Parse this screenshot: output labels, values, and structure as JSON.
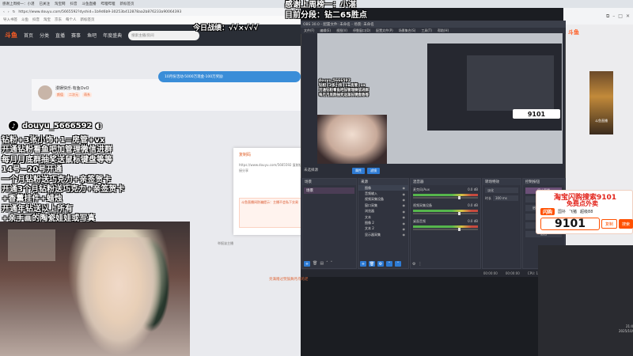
{
  "browser": {
    "tabs": [
      "感谢上周榜一：小湛",
      "已关注",
      "淘宝网",
      "抖音",
      "斗鱼直播",
      "哔哩哔哩",
      "新标签页"
    ],
    "url": "https://www.douyu.com/5665592?dyshid=1b9d6b9-30253b412878aa2b876233a90064393",
    "bookmarks": [
      "导入书签",
      "斗鱼",
      "抖音",
      "淘宝",
      "京东",
      "每个人",
      "新标签页"
    ]
  },
  "nav": {
    "logo": "斗鱼",
    "items": [
      "首页",
      "分类",
      "直播",
      "赛事",
      "鱼吧",
      "年度盛典"
    ],
    "search_placeholder": "搜索主播/房间"
  },
  "room": {
    "streamer_name": "漫娱快乐·有鱼OvO",
    "tags": [
      "颜值",
      "二次元",
      "萌系"
    ],
    "banner": "10月份活动·5000万现金·100万奖励"
  },
  "overlay": {
    "top_line1": "感谢上周榜一：小湛",
    "top_line2": "目前分段：钻二65胜点",
    "battle": "今日战绩：√√×√√√",
    "tiktok_handle": "douyu_5666592",
    "lines": [
      "钻粉+3张小饰+1=房管+vx",
      "开通钻粉看鱼吧加管理微信进群",
      "每月月底群抽奖送鼠标键盘等等",
      "14号~20号开通",
      "一个月钻粉送巧克力+亲签贺卡",
      "开通3个月钻粉送巧克力+亲签贺卡",
      "+香薰挂件+蜡烛",
      "开通年钻送以上所有",
      "+亲手画的陶瓷娃娃或写真"
    ]
  },
  "dialog": {
    "title": "复制码",
    "body": "https://www.douyu.com/5665592 复制链接分享",
    "warning": "斗鱼直播间防骗提示：主播不会私下交易",
    "link": "举报该主播"
  },
  "bottom_msg": "亮满赠过赞鼓舞月舟的老",
  "obs": {
    "title": "OBS 30.0 - 配置文件: 未命名 - 场景: 未命名",
    "menu": [
      "文件(F)",
      "编辑(E)",
      "视图(V)",
      "停靠窗口(D)",
      "配置文件(P)",
      "场景集合(S)",
      "工具(T)",
      "帮助(H)"
    ],
    "scene_label": "未选择源",
    "preview_buttons": [
      "属性",
      "滤镜"
    ],
    "preview_overlay": [
      "douyu_5666592",
      "钻粉+3张小饰+1=房管+vx",
      "开通钻粉看鱼吧加管理微信进群",
      "每月月底群抽奖送鼠标键盘等等"
    ],
    "preview_code": "9101",
    "panels": {
      "scenes": {
        "title": "场景",
        "items": [
          "场景"
        ]
      },
      "sources": {
        "title": "来源",
        "items": [
          "图像",
          "音频输入",
          "视频采集设备",
          "窗口采集",
          "浏览器",
          "文本",
          "图像 2",
          "文本 2",
          "显示器采集"
        ]
      },
      "mixer": {
        "title": "混音器",
        "channels": [
          {
            "name": "麦克风/Aux",
            "db": "0.0 dB"
          },
          {
            "name": "视频采集设备",
            "db": "0.0 dB"
          },
          {
            "name": "桌面音频",
            "db": "0.0 dB"
          }
        ]
      },
      "transitions": {
        "title": "转场特效",
        "type": "淡化",
        "duration_label": "时长",
        "duration": "300 ms"
      },
      "controls": {
        "title": "控制按钮",
        "buttons": [
          "停止直播",
          "开始录制",
          "启动虚拟摄像机",
          "工作室模式",
          "设置",
          "退出"
        ]
      }
    },
    "status": {
      "live": "00:00:00",
      "rec": "00:00:00",
      "cpu": "CPU: 1.8%, 60.00 fps"
    }
  },
  "promo": {
    "title": "淘宝闪购搜索9101",
    "subtitle": "免费点外卖",
    "brand": "闪购",
    "items": [
      "国补",
      "飞猪",
      "超级88"
    ],
    "code": "9101",
    "copy_btn": "复制",
    "search_btn": "搜索"
  },
  "right": {
    "logo": "斗鱼",
    "thumb_text": "斗鱼直播",
    "clock": "21:49 2025/10/1"
  },
  "colors": {
    "accent": "#ff5d23",
    "obs_bg": "#2b2e38",
    "promo_red": "#e2231a"
  }
}
